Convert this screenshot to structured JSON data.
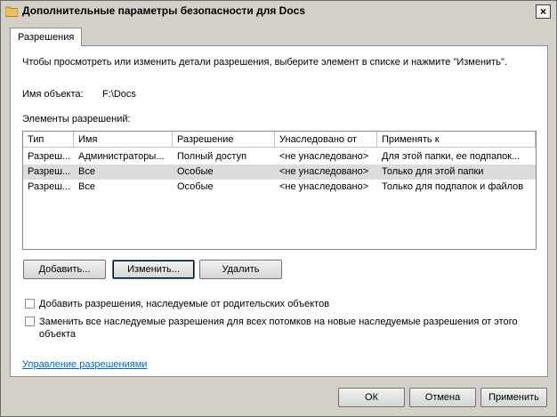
{
  "window": {
    "title": "Дополнительные параметры безопасности для Docs",
    "close": "×"
  },
  "tabs": [
    {
      "label": "Разрешения"
    }
  ],
  "permissions": {
    "intro": "Чтобы просмотреть или изменить детали разрешения, выберите элемент в списке и нажмите \"Изменить\".",
    "object_label": "Имя объекта:",
    "object_value": "F:\\Docs",
    "entries_label": "Элементы разрешений:",
    "columns": [
      "Тип",
      "Имя",
      "Разрешение",
      "Унаследовано от",
      "Применять к"
    ],
    "rows": [
      [
        "Разреш...",
        "Администраторы...",
        "Полный доступ",
        "<не унаследовано>",
        "Для этой папки, ее подпапок..."
      ],
      [
        "Разреш...",
        "Все",
        "Особые",
        "<не унаследовано>",
        "Только для этой папки"
      ],
      [
        "Разреш...",
        "Все",
        "Особые",
        "<не унаследовано>",
        "Только для подпапок и файлов"
      ]
    ],
    "selected_row": 1,
    "buttons": {
      "add": "Добавить...",
      "edit": "Изменить...",
      "remove": "Удалить"
    },
    "inherit_checkbox": "Добавить разрешения, наследуемые от родительских объектов",
    "replace_checkbox_line1": "Заменить все наследуемые разрешения для всех потомков на новые наследуемые разрешения от этого",
    "replace_checkbox_line2": "объекта",
    "inherit_checked": false,
    "replace_checked": false,
    "manage_link": "Управление разрешениями"
  },
  "footer": {
    "ok": "ОК",
    "cancel": "Отмена",
    "apply": "Применить"
  },
  "colors": {
    "link": "#0066cc",
    "selected_row": "#dcdcdc",
    "folder": "#e8c15a"
  }
}
